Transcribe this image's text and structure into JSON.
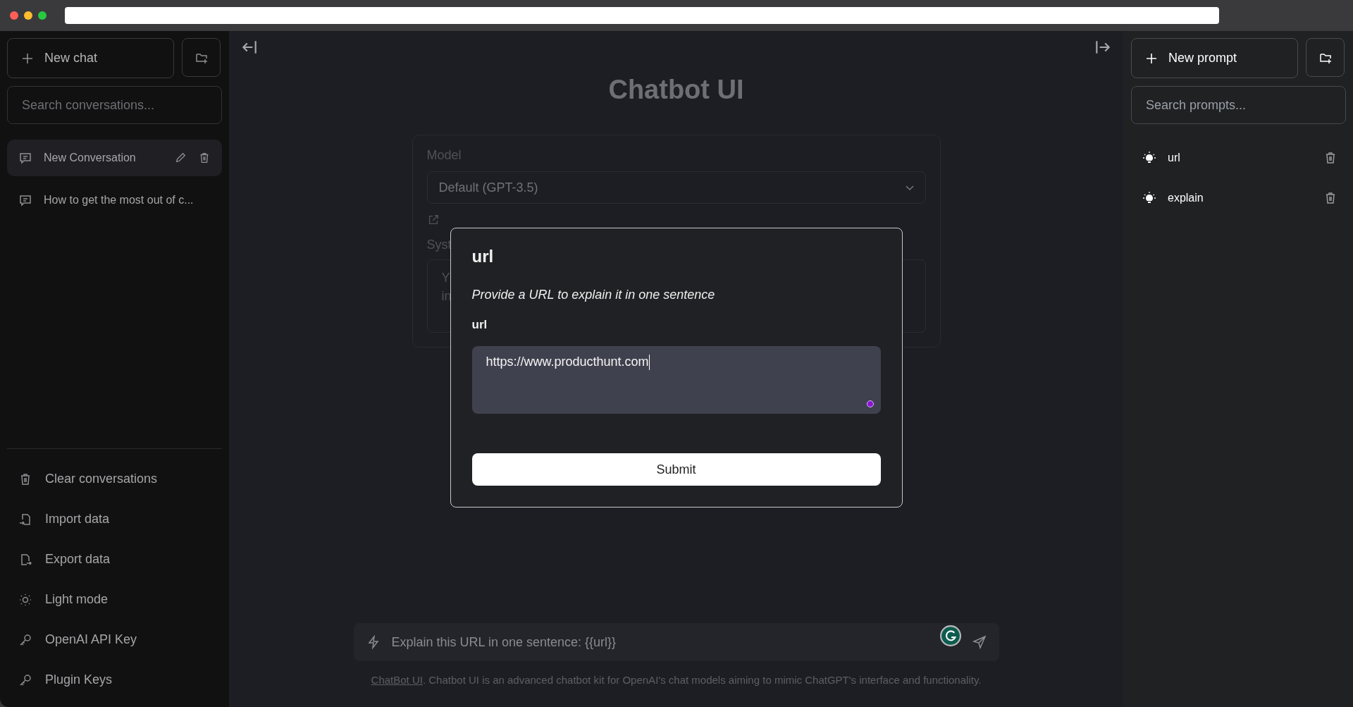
{
  "left_sidebar": {
    "new_chat_button": "New chat",
    "search": {
      "placeholder": "Search conversations..."
    },
    "conversations": [
      {
        "title": "New Conversation",
        "selected": true
      },
      {
        "title": "How to get the most out of c...",
        "selected": false
      }
    ],
    "menu": [
      "Clear conversations",
      "Import data",
      "Export data",
      "Light mode",
      "OpenAI API Key",
      "Plugin Keys"
    ]
  },
  "main": {
    "title": "Chatbot UI",
    "settings": {
      "model_label": "Model",
      "model_value": "Default (GPT-3.5)",
      "system_label": "Syst",
      "system_prompt_lines": [
        "Y",
        "in"
      ]
    },
    "chat_input": {
      "value": "Explain this URL in one sentence: {{url}}"
    },
    "footer": {
      "link": "ChatBot UI",
      "text": ". Chatbot UI is an advanced chatbot kit for OpenAI's chat models aiming to mimic ChatGPT's interface and functionality."
    }
  },
  "modal": {
    "title": "url",
    "description": "Provide a URL to explain it in one sentence",
    "field_label": "url",
    "field_value": "https://www.producthunt.com",
    "submit": "Submit"
  },
  "right_sidebar": {
    "new_prompt_button": "New prompt",
    "search": {
      "placeholder": "Search prompts..."
    },
    "prompts": [
      {
        "name": "url"
      },
      {
        "name": "explain"
      }
    ]
  }
}
